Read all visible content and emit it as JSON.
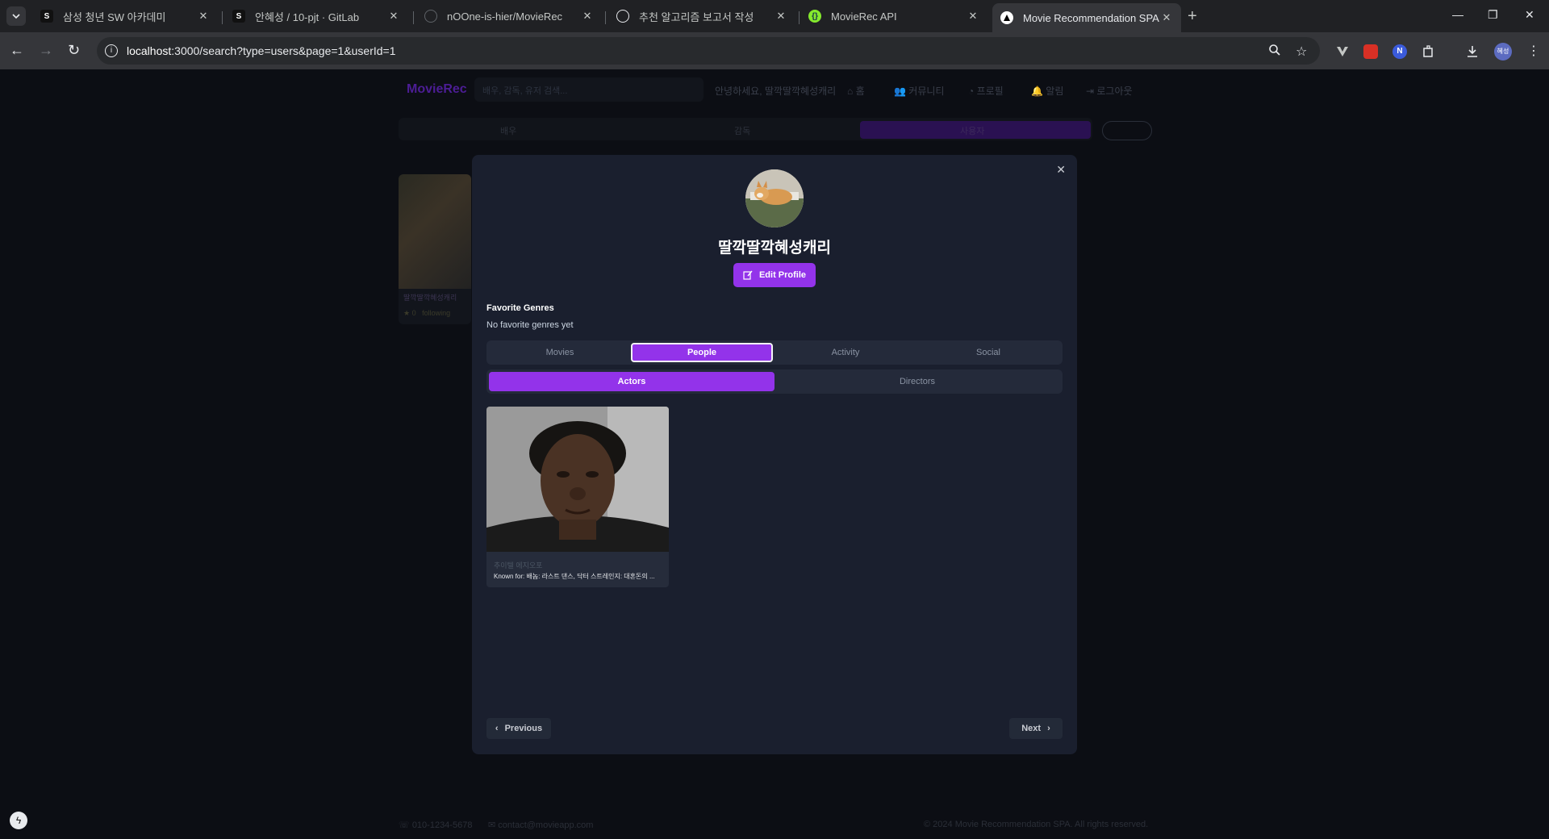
{
  "browser": {
    "tabs": [
      {
        "title": "삼성 청년 SW 아카데미",
        "favicon": "ssafy-icon"
      },
      {
        "title": "안혜성 / 10-pjt · GitLab",
        "favicon": "gitlab-icon"
      },
      {
        "title": "nOOne-is-hier/MovieRec",
        "favicon": "github-icon"
      },
      {
        "title": "추천 알고리즘 보고서 작성",
        "favicon": "chatgpt-icon"
      },
      {
        "title": "MovieRec API",
        "favicon": "swagger-icon"
      },
      {
        "title": "Movie Recommendation SPA",
        "favicon": "vercel-icon",
        "active": true
      }
    ],
    "url_host": "localhost",
    "url_rest": ":3000/search?type=users&page=1&userId=1",
    "profile_initials": "혜성"
  },
  "background_app": {
    "logo": "MovieRec",
    "search_placeholder": "배우, 감독, 유저 검색...",
    "greeting": "안녕하세요, 딸깍딸깍혜성캐리",
    "nav": [
      "홈",
      "커뮤니티",
      "프로필",
      "알림",
      "로그아웃"
    ],
    "search_tabs": [
      "배우",
      "감독",
      "사용자"
    ],
    "card": {
      "name": "딸깍딸깍혜성캐리",
      "rating": "0",
      "status": "following"
    },
    "footer": {
      "phone": "010-1234-5678",
      "email": "contact@movieapp.com",
      "copyright": "© 2024 Movie Recommendation SPA. All rights reserved."
    }
  },
  "modal": {
    "username": "딸깍딸깍혜성캐리",
    "edit_button": "Edit Profile",
    "favorite_genres_title": "Favorite Genres",
    "favorite_genres_empty": "No favorite genres yet",
    "tabs": [
      "Movies",
      "People",
      "Activity",
      "Social"
    ],
    "active_tab": "People",
    "subtabs": [
      "Actors",
      "Directors"
    ],
    "active_subtab": "Actors",
    "people": [
      {
        "name": "추이텔 에지오포",
        "known_for": "Known for: 배놈: 라스트 댄스, 닥터 스트레인지: 대혼돈의 ..."
      }
    ],
    "pagination": {
      "prev": "Previous",
      "next": "Next"
    }
  },
  "colors": {
    "accent": "#9333ea",
    "modal_bg": "#1a1f2e",
    "page_bg": "#0c0e14"
  }
}
